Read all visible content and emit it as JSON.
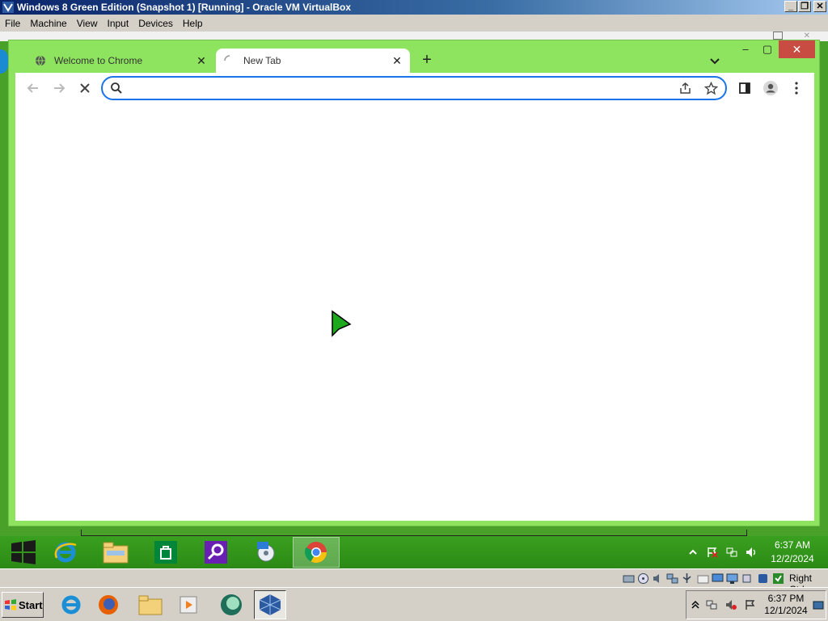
{
  "host": {
    "title": "Windows 8 Green Edition (Snapshot 1) [Running] - Oracle VM VirtualBox",
    "menu": [
      "File",
      "Machine",
      "View",
      "Input",
      "Devices",
      "Help"
    ],
    "status_right": "Right Ctrl",
    "taskbar": {
      "start_label": "Start",
      "clock_time": "6:37 PM",
      "clock_date": "12/1/2024"
    }
  },
  "browser": {
    "tabs": [
      {
        "label": "Welcome to Chrome",
        "state": "inactive"
      },
      {
        "label": "New Tab",
        "state": "active-loading"
      }
    ],
    "omnibox": {
      "value": "",
      "placeholder": ""
    },
    "colors": {
      "frame": "#8ee45f",
      "focus": "#1a73e8",
      "close": "#c94c43"
    }
  },
  "guest": {
    "clock_time": "6:37 AM",
    "clock_date": "12/2/2024",
    "pinned_apps": [
      "windows-logo",
      "internet-explorer",
      "file-explorer",
      "store",
      "search",
      "media",
      "chrome"
    ]
  }
}
